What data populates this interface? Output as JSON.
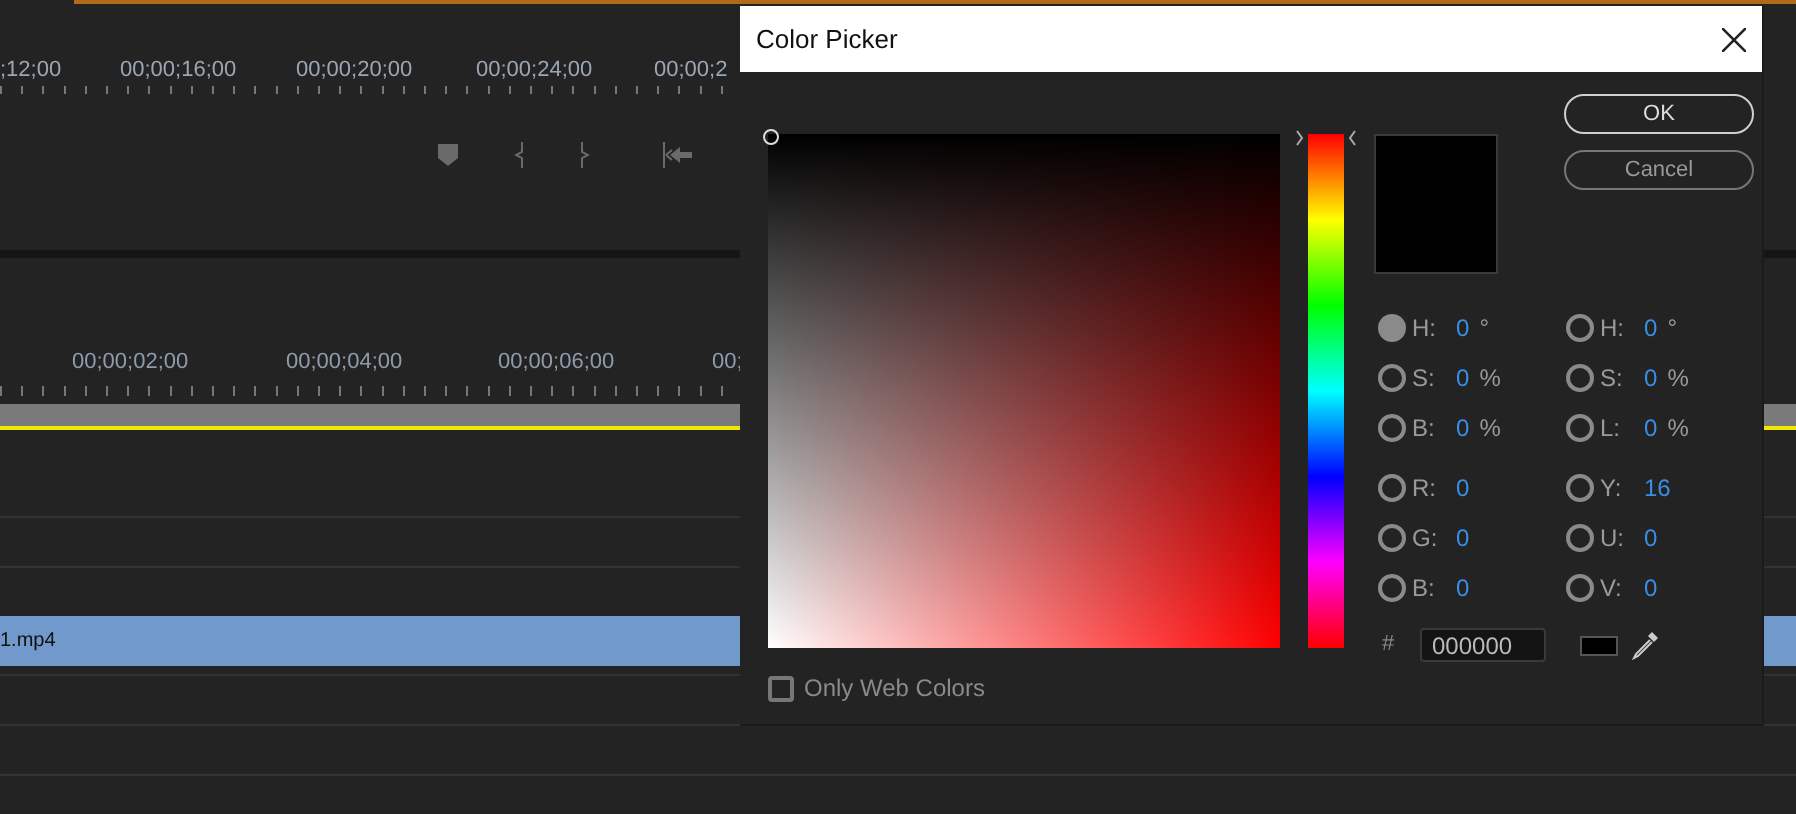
{
  "timeline": {
    "top_ruler": [
      ";12;00",
      "00;00;16;00",
      "00;00;20;00",
      "00;00;24;00",
      "00;00;2"
    ],
    "bottom_ruler": [
      "00;00;02;00",
      "00;00;04;00",
      "00;00;06;00",
      "00;"
    ],
    "clip": {
      "name": "1.mp4"
    }
  },
  "dialog": {
    "title": "Color Picker",
    "buttons": [
      {
        "label": "OK",
        "kind": "default"
      },
      {
        "label": "Cancel",
        "kind": "normal"
      }
    ],
    "hue_slider": {
      "level": 0
    },
    "fields_left": [
      {
        "label": "H:",
        "value": "0",
        "unit": "°",
        "selected": true
      },
      {
        "label": "S:",
        "value": "0",
        "unit": "%",
        "selected": false
      },
      {
        "label": "B:",
        "value": "0",
        "unit": "%",
        "selected": false
      },
      {
        "label": "R:",
        "value": "0",
        "selected": false
      },
      {
        "label": "G:",
        "value": "0",
        "selected": false
      },
      {
        "label": "B:",
        "value": "0",
        "selected": false
      }
    ],
    "fields_right": [
      {
        "label": "H:",
        "value": "0",
        "unit": "°",
        "selected": false
      },
      {
        "label": "S:",
        "value": "0",
        "unit": "%",
        "selected": false
      },
      {
        "label": "L:",
        "value": "0",
        "unit": "%",
        "selected": false
      },
      {
        "label": "Y:",
        "value": "16",
        "selected": false
      },
      {
        "label": "U:",
        "value": "0",
        "selected": false
      },
      {
        "label": "V:",
        "value": "0",
        "selected": false
      }
    ],
    "hex": {
      "label": "#",
      "value": "000000"
    },
    "only_web_colors": {
      "label": "Only Web Colors",
      "checked": false
    }
  }
}
